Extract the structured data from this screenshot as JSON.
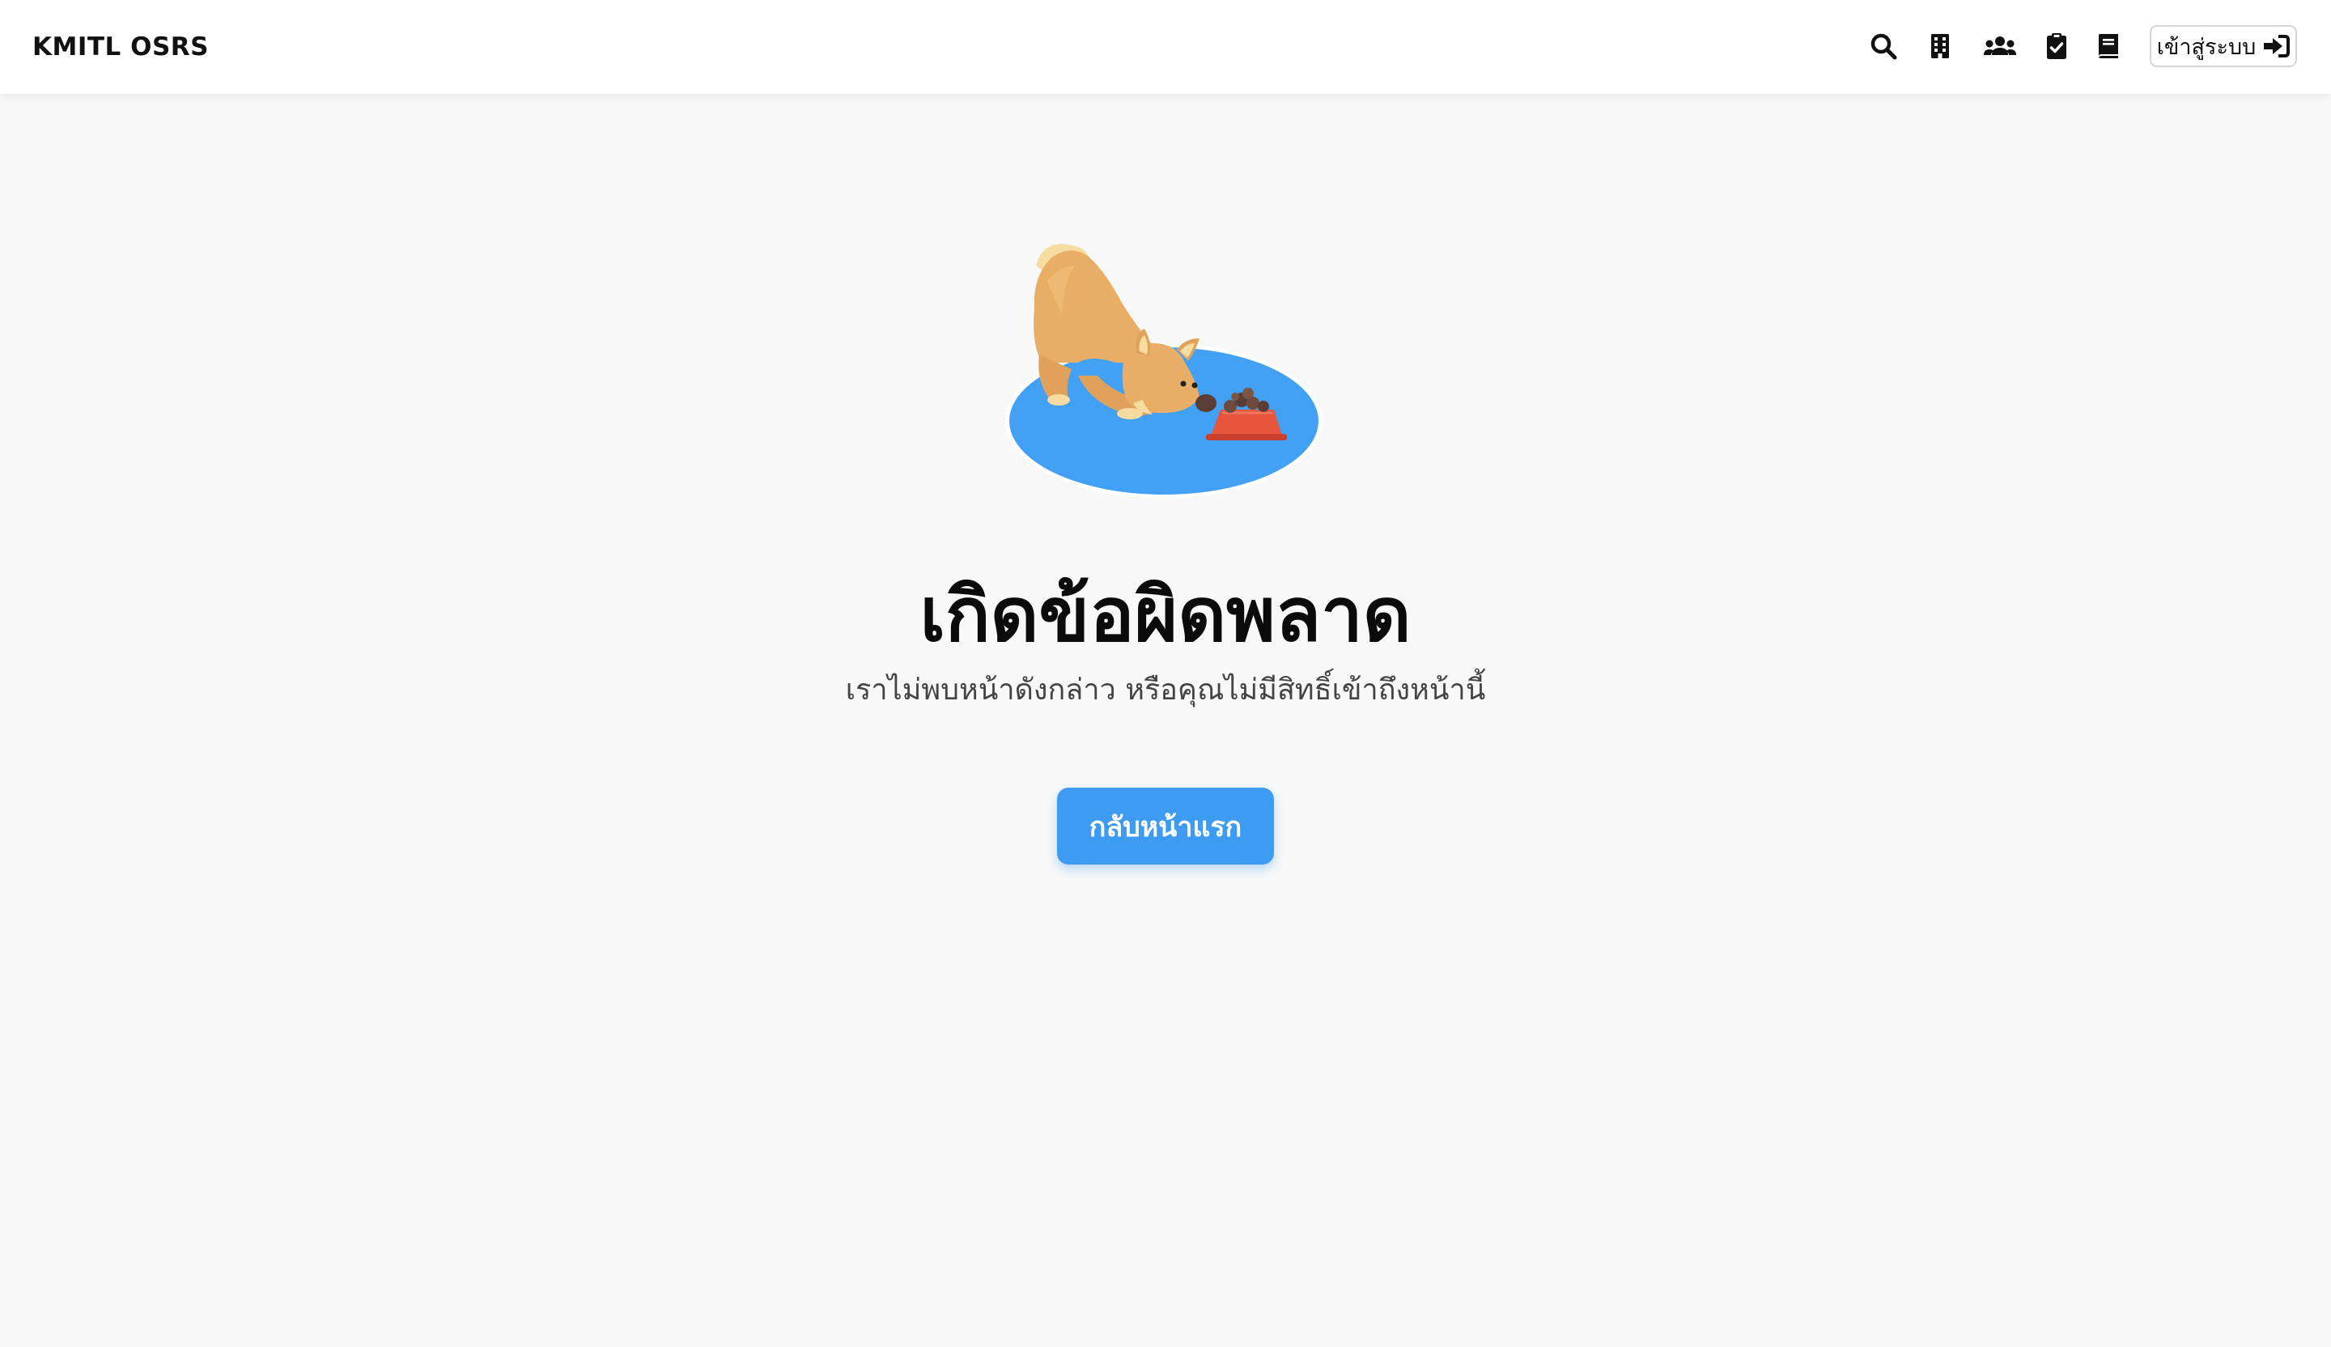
{
  "navbar": {
    "brand": "KMITL OSRS",
    "icons": [
      "search-icon",
      "building-icon",
      "users-icon",
      "clipboard-check-icon",
      "book-icon"
    ],
    "login_label": "เข้าสู่ระบบ",
    "login_icon": "sign-in-icon"
  },
  "error": {
    "illustration": "dog-eating-illustration",
    "title": "เกิดข้อผิดพลาด",
    "message": "เราไม่พบหน้าดังกล่าว หรือคุณไม่มีสิทธิ์เข้าถึงหน้านี้",
    "home_button": "กลับหน้าแรก"
  },
  "colors": {
    "accent": "#3d9cf2",
    "background": "#f8f8f8",
    "navbar": "#ffffff"
  }
}
